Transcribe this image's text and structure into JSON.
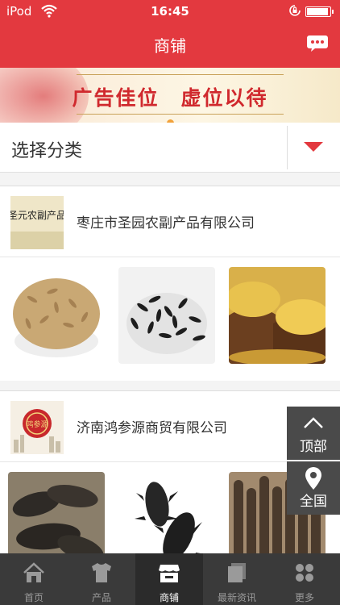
{
  "status_bar": {
    "carrier": "iPod",
    "time": "16:45",
    "battery_level": 0.9
  },
  "nav": {
    "title": "商铺"
  },
  "banner": {
    "text": "广告佳位　虚位以待"
  },
  "category": {
    "label": "选择分类"
  },
  "shops": [
    {
      "name": "枣庄市圣园农副产品有限公司",
      "logo_text": "圣元农副产品"
    },
    {
      "name": "济南鸿参源商贸有限公司",
      "logo_text": "鸿参源"
    }
  ],
  "float_buttons": {
    "top_label": "顶部",
    "all_label": "全国"
  },
  "tabs": [
    {
      "label": "首页",
      "icon": "home-icon"
    },
    {
      "label": "产品",
      "icon": "shirt-icon"
    },
    {
      "label": "商铺",
      "icon": "shop-icon",
      "active": true
    },
    {
      "label": "最新资讯",
      "icon": "news-icon"
    },
    {
      "label": "更多",
      "icon": "more-icon"
    }
  ],
  "colors": {
    "brand": "#e3393f",
    "tab_bar": "#3a3a3a"
  }
}
